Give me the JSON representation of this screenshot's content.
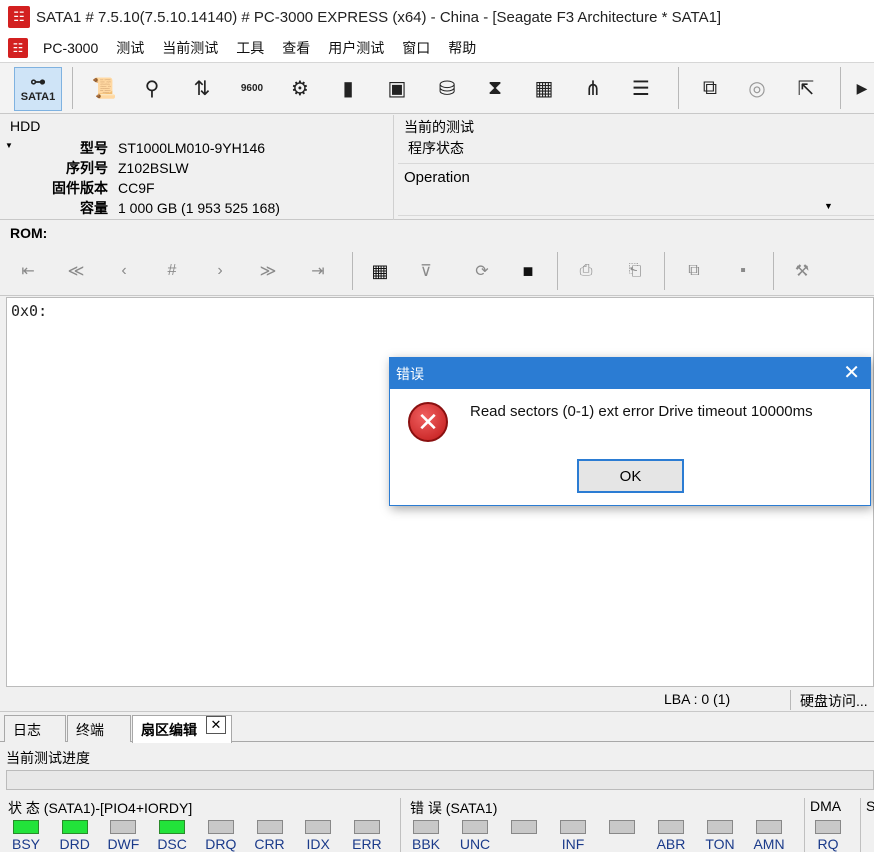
{
  "window": {
    "logo": "🀄",
    "title": "SATA1 # 7.5.10(7.5.10.14140) # PC-3000 EXPRESS (x64) - China - [Seagate F3 Architecture * SATA1]"
  },
  "menu": [
    "PC-3000",
    "测试",
    "当前测试",
    "工具",
    "查看",
    "用户测试",
    "窗口",
    "帮助"
  ],
  "toolbar": {
    "sata_label": "SATA1"
  },
  "hdd": {
    "label": "HDD",
    "model_key": "型号",
    "model": "ST1000LM010-9YH146",
    "serial_key": "序列号",
    "serial": "Z102BSLW",
    "firmware_key": "固件版本",
    "firmware": "CC9F",
    "capacity_key": "容量",
    "capacity": "1 000 GB (1 953 525 168)"
  },
  "current_test": {
    "label": "当前的测试",
    "status_label": "程序状态",
    "operation_label": "Operation"
  },
  "rom": {
    "label": "ROM:",
    "hex_first_line": "0x0:"
  },
  "statusbar": {
    "lba": "LBA : 0 (1)",
    "disk_access": "硬盘访问..."
  },
  "tabs": [
    {
      "label": "日志"
    },
    {
      "label": "终端"
    },
    {
      "label": "扇区编辑"
    }
  ],
  "tab_close": "✕",
  "progress": {
    "label": "当前测试进度",
    "fraction": 0
  },
  "status_panel": {
    "status_title": "状 态 (SATA1)-[PIO4+IORDY]",
    "error_title": "错 误 (SATA1)",
    "dma_title": "DMA",
    "s_title": "S",
    "status_leds": [
      {
        "label": "BSY",
        "on": true
      },
      {
        "label": "DRD",
        "on": true
      },
      {
        "label": "DWF",
        "on": false
      },
      {
        "label": "DSC",
        "on": true
      },
      {
        "label": "DRQ",
        "on": false
      },
      {
        "label": "CRR",
        "on": false
      },
      {
        "label": "IDX",
        "on": false
      },
      {
        "label": "ERR",
        "on": false
      }
    ],
    "error_leds": [
      {
        "label": "BBK",
        "on": false
      },
      {
        "label": "UNC",
        "on": false
      },
      {
        "label": "",
        "on": false
      },
      {
        "label": "INF",
        "on": false
      },
      {
        "label": "",
        "on": false
      },
      {
        "label": "ABR",
        "on": false
      },
      {
        "label": "TON",
        "on": false
      },
      {
        "label": "AMN",
        "on": false
      }
    ],
    "dma_led": {
      "label": "RQ",
      "on": false
    }
  },
  "dialog": {
    "title": "错误",
    "message": "Read sectors (0-1) ext error Drive timeout 10000ms",
    "ok_label": "OK",
    "close_glyph": "✕"
  },
  "colors": {
    "accent": "#2b7cd3",
    "led_on": "#22e33a",
    "led_off": "#c8c8c8",
    "error_red": "#c01818"
  }
}
